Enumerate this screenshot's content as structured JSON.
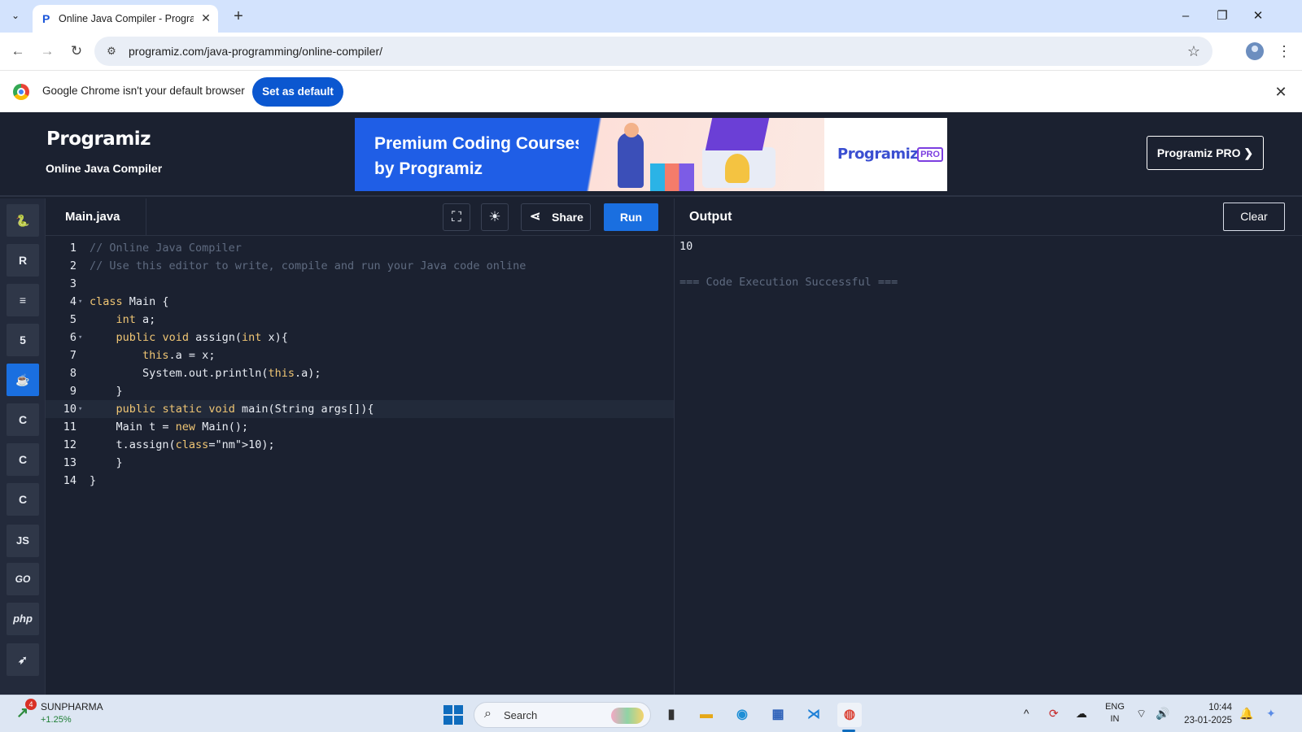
{
  "browser": {
    "tab_title": "Online Java Compiler - Programiz",
    "url": "programiz.com/java-programming/online-compiler/",
    "infobar_text": "Google Chrome isn't your default browser",
    "set_default_label": "Set as default"
  },
  "site": {
    "logo_text": "Programiz",
    "subtitle": "Online Java Compiler",
    "banner_text": "Premium Coding Courses by Programiz",
    "banner_brand": "Programiz",
    "banner_pro_badge": "PRO",
    "pro_button_label": "Programiz PRO ❯"
  },
  "languages": [
    {
      "name": "python",
      "glyph": "🐍"
    },
    {
      "name": "r",
      "glyph": "R"
    },
    {
      "name": "sql",
      "glyph": "≡"
    },
    {
      "name": "html",
      "glyph": "5"
    },
    {
      "name": "java",
      "glyph": "☕"
    },
    {
      "name": "c",
      "glyph": "C"
    },
    {
      "name": "cpp",
      "glyph": "C"
    },
    {
      "name": "csharp",
      "glyph": "C"
    },
    {
      "name": "js",
      "glyph": "JS"
    },
    {
      "name": "go",
      "glyph": "GO"
    },
    {
      "name": "php",
      "glyph": "php"
    },
    {
      "name": "swift",
      "glyph": "➶"
    }
  ],
  "editor": {
    "file_name": "Main.java",
    "share_label": "Share",
    "run_label": "Run",
    "lines": [
      "// Online Java Compiler",
      "// Use this editor to write, compile and run your Java code online",
      "",
      "class Main {",
      "    int a;",
      "    public void assign(int x){",
      "        this.a = x;",
      "        System.out.println(this.a);",
      "    }",
      "    public static void main(String args[]){",
      "    Main t = new Main();",
      "    t.assign(10);",
      "    }",
      "}"
    ]
  },
  "output": {
    "title": "Output",
    "clear_label": "Clear",
    "value": "10",
    "status": "=== Code Execution Successful ==="
  },
  "taskbar": {
    "stock_name": "SUNPHARMA",
    "stock_change": "+1.25%",
    "stock_badge": "4",
    "search_label": "Search",
    "lang_line1": "ENG",
    "lang_line2": "IN",
    "time": "10:44",
    "date": "23-01-2025"
  },
  "colors": {
    "accent": "#1a6fe0",
    "background": "#1b2130",
    "comment": "#5f6b80",
    "keyword": "#f0c674",
    "number": "#e8695f"
  }
}
